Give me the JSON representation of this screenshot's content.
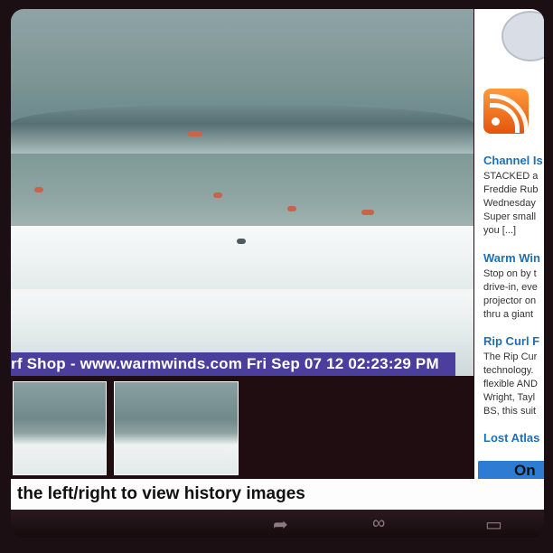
{
  "webcam": {
    "overlay_text": "rf Shop - www.warmwinds.com Fri Sep 07 12 02:23:29 PM"
  },
  "thumbnails": [
    {
      "label": "history-image-1"
    },
    {
      "label": "history-image-2"
    }
  ],
  "sidebar": {
    "posts": [
      {
        "title": "Channel Is",
        "lines": [
          "STACKED a",
          "Freddie Rub",
          "Wednesday",
          "Super small",
          "you [...]"
        ]
      },
      {
        "title": "Warm Win",
        "lines": [
          "Stop on by t",
          "drive-in, eve",
          "projector on",
          "thru a giant"
        ]
      },
      {
        "title": "Rip Curl F",
        "lines": [
          "The Rip Cur",
          "technology.",
          "flexible AND",
          "Wright, Tayl",
          "BS, this suit"
        ]
      },
      {
        "title": "Lost Atlas",
        "lines": []
      }
    ],
    "online_label": "On"
  },
  "hint": {
    "text": "the left/right to view history images"
  },
  "colors": {
    "banner": "#4a3f9c",
    "link": "#1f6fb4",
    "rss": "#e3550d"
  },
  "icons": [
    "rss-icon",
    "share-icon",
    "bookmarks-icon",
    "tabs-icon"
  ]
}
